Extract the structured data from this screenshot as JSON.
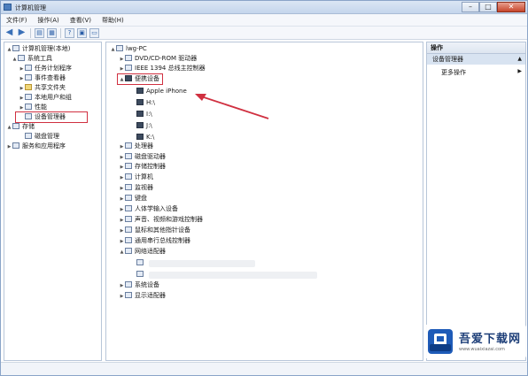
{
  "window": {
    "title": "计算机管理"
  },
  "menu": [
    "文件(F)",
    "操作(A)",
    "查看(V)",
    "帮助(H)"
  ],
  "left_tree": [
    {
      "label": "计算机管理(本地)",
      "indent": 0,
      "arrow": "▲"
    },
    {
      "label": "系统工具",
      "indent": 1,
      "arrow": "▲"
    },
    {
      "label": "任务计划程序",
      "indent": 2,
      "arrow": "▶"
    },
    {
      "label": "事件查看器",
      "indent": 2,
      "arrow": "▶"
    },
    {
      "label": "共享文件夹",
      "indent": 2,
      "arrow": "▶"
    },
    {
      "label": "本地用户和组",
      "indent": 2,
      "arrow": "▶"
    },
    {
      "label": "性能",
      "indent": 2,
      "arrow": "▶"
    },
    {
      "label": "设备管理器",
      "indent": 2,
      "arrow": ""
    },
    {
      "label": "存储",
      "indent": 1,
      "arrow": "▲"
    },
    {
      "label": "磁盘管理",
      "indent": 2,
      "arrow": ""
    },
    {
      "label": "服务和应用程序",
      "indent": 1,
      "arrow": "▶"
    }
  ],
  "device_tree": [
    {
      "label": "lwg-PC",
      "indent": 0,
      "arrow": "▲"
    },
    {
      "label": "DVD/CD-ROM 驱动器",
      "indent": 1,
      "arrow": "▶"
    },
    {
      "label": "IEEE 1394 总线主控制器",
      "indent": 1,
      "arrow": "▶"
    },
    {
      "label": "便携设备",
      "indent": 1,
      "arrow": "▲"
    },
    {
      "label": "Apple iPhone",
      "indent": 2,
      "arrow": ""
    },
    {
      "label": "H:\\",
      "indent": 2,
      "arrow": ""
    },
    {
      "label": "I:\\",
      "indent": 2,
      "arrow": ""
    },
    {
      "label": "J:\\",
      "indent": 2,
      "arrow": ""
    },
    {
      "label": "K:\\",
      "indent": 2,
      "arrow": ""
    },
    {
      "label": "处理器",
      "indent": 1,
      "arrow": "▶"
    },
    {
      "label": "磁盘驱动器",
      "indent": 1,
      "arrow": "▶"
    },
    {
      "label": "存储控制器",
      "indent": 1,
      "arrow": "▶"
    },
    {
      "label": "计算机",
      "indent": 1,
      "arrow": "▶"
    },
    {
      "label": "监视器",
      "indent": 1,
      "arrow": "▶"
    },
    {
      "label": "键盘",
      "indent": 1,
      "arrow": "▶"
    },
    {
      "label": "人体学输入设备",
      "indent": 1,
      "arrow": "▶"
    },
    {
      "label": "声音、视频和游戏控制器",
      "indent": 1,
      "arrow": "▶"
    },
    {
      "label": "鼠标和其他指针设备",
      "indent": 1,
      "arrow": "▶"
    },
    {
      "label": "通用串行总线控制器",
      "indent": 1,
      "arrow": "▶"
    },
    {
      "label": "网络适配器",
      "indent": 1,
      "arrow": "▲"
    },
    {
      "label": "",
      "indent": 2,
      "arrow": ""
    },
    {
      "label": "",
      "indent": 2,
      "arrow": ""
    },
    {
      "label": "系统设备",
      "indent": 1,
      "arrow": "▶"
    },
    {
      "label": "显示适配器",
      "indent": 1,
      "arrow": "▶"
    }
  ],
  "actions": {
    "header": "操作",
    "selected": "设备管理器",
    "more": "更多操作"
  },
  "watermark": {
    "brand": "吾爱下载网",
    "url": "www.wuaixiazai.com"
  },
  "colors": {
    "highlight_box": "#d03040",
    "arrow": "#d03040"
  }
}
